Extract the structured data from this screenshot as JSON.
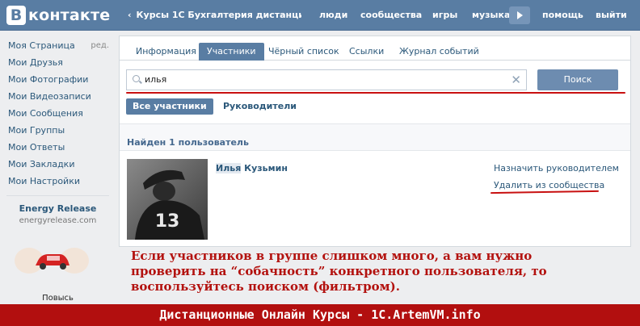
{
  "header": {
    "logo_letter": "В",
    "logo_text": "контакте",
    "chevron": "‹",
    "group_title": "Курсы 1С Бухгалтерия дистанци...",
    "nav": [
      "люди",
      "сообщества",
      "игры",
      "музыка",
      "помощь",
      "выйти"
    ]
  },
  "sidebar": {
    "items": [
      "Моя Страница",
      "Мои Друзья",
      "Мои Фотографии",
      "Мои Видеозаписи",
      "Мои Сообщения",
      "Мои Группы",
      "Мои Ответы",
      "Мои Закладки",
      "Мои Настройки"
    ],
    "edit_label": "ред.",
    "ad": {
      "title": "Energy Release",
      "domain": "energyrelease.com",
      "caption": "Повысь"
    }
  },
  "tabs": [
    "Информация",
    "Участники",
    "Чёрный список",
    "Ссылки",
    "Журнал событий"
  ],
  "active_tab": "Участники",
  "search": {
    "value": "илья",
    "clear_icon": "✕",
    "button_label": "Поиск"
  },
  "filters": {
    "all": "Все участники",
    "leaders": "Руководители"
  },
  "results": {
    "found_text": "Найден 1 пользователь",
    "user": {
      "name_highlight": "Илья",
      "name_rest": " Кузьмин",
      "jersey_number": "13"
    },
    "actions": {
      "make_leader": "Назначить руководителем",
      "remove": "Удалить из сообщества"
    }
  },
  "annotation": {
    "line1": "Если участников в группе слишком много, а вам нужно",
    "line2": "проверить на “собачность” конкретного пользователя, то",
    "line3": "воспользуйтесь поиском (фильтром)."
  },
  "footer": {
    "text": "Дистанционные Онлайн Курсы - 1C.ArtemVM.info"
  },
  "colors": {
    "brand": "#597da3",
    "link": "#2b587a",
    "accent_red": "#b20f0f"
  }
}
